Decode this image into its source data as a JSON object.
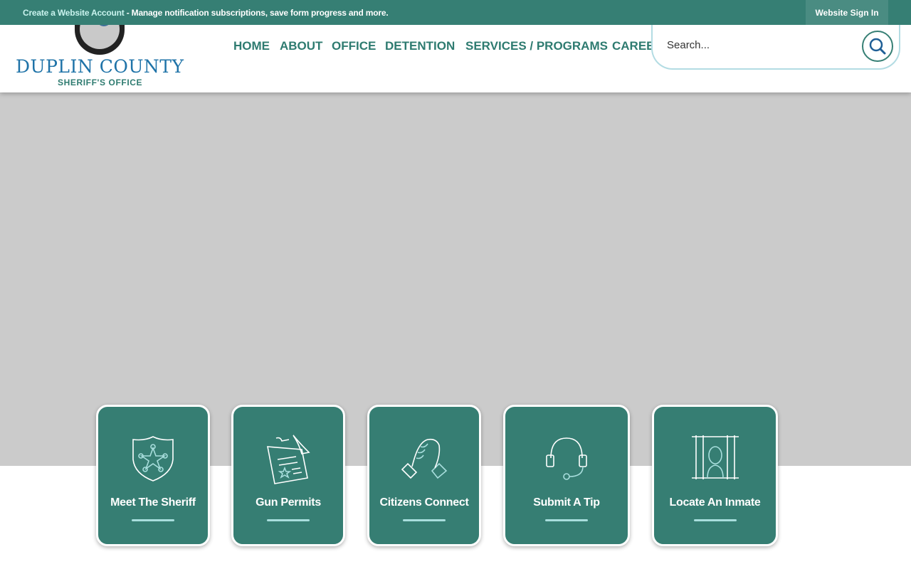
{
  "topbar": {
    "account_link": "Create a Website Account",
    "message": " - Manage notification subscriptions, save form progress and more.",
    "sign_in": "Website Sign In"
  },
  "logo": {
    "title": "DUPLIN COUNTY",
    "subtitle": "SHERIFF'S OFFICE",
    "seal_text": "SHERIFF'S OFFICE"
  },
  "nav": [
    "HOME",
    "ABOUT",
    "OFFICE",
    "DETENTION",
    "SERVICES / PROGRAMS",
    "CAREERS"
  ],
  "search": {
    "placeholder": "Search..."
  },
  "cards": [
    {
      "label": "Meet The Sheriff",
      "icon": "shield-star-icon"
    },
    {
      "label": "Gun Permits",
      "icon": "permit-document-icon"
    },
    {
      "label": "Citizens Connect",
      "icon": "handshake-icon"
    },
    {
      "label": "Submit A Tip",
      "icon": "headset-icon"
    },
    {
      "label": "Locate An Inmate",
      "icon": "inmate-bars-icon"
    }
  ],
  "colors": {
    "brand": "#367f74",
    "logo_blue": "#1f73a8",
    "hero_gray": "#cbcbcb"
  }
}
